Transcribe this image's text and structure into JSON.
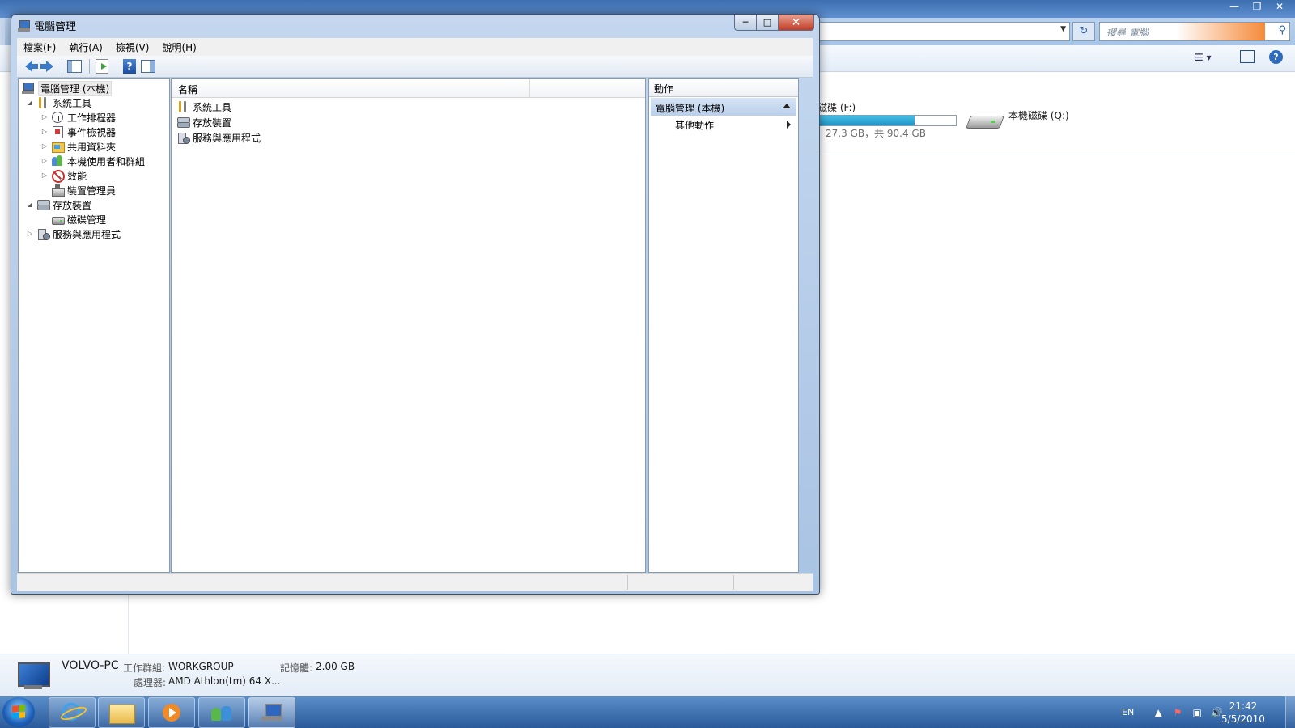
{
  "background_explorer": {
    "search_placeholder": "搜尋 電腦",
    "drive_f": {
      "label": "磁碟 (F:)",
      "info": "27.3 GB，共 90.4 GB",
      "used_fraction": 0.7
    },
    "drive_q": {
      "label": "本機磁碟 (Q:)"
    },
    "details": {
      "pc_name": "VOLVO-PC",
      "workgroup_label": "工作群組:",
      "workgroup_value": "WORKGROUP",
      "memory_label": "記憶體:",
      "memory_value": "2.00 GB",
      "processor_label": "處理器:",
      "processor_value": "AMD Athlon(tm) 64 X..."
    }
  },
  "window": {
    "title": "電腦管理"
  },
  "menu": {
    "items": [
      "檔案(F)",
      "執行(A)",
      "檢視(V)",
      "說明(H)"
    ]
  },
  "tree": {
    "root": "電腦管理 (本機)",
    "items": [
      {
        "label": "系統工具",
        "level": 1,
        "expander": "expanded"
      },
      {
        "label": "工作排程器",
        "level": 2,
        "expander": "collapsed"
      },
      {
        "label": "事件檢視器",
        "level": 2,
        "expander": "collapsed"
      },
      {
        "label": "共用資料夾",
        "level": 2,
        "expander": "collapsed"
      },
      {
        "label": "本機使用者和群組",
        "level": 2,
        "expander": "collapsed"
      },
      {
        "label": "效能",
        "level": 2,
        "expander": "collapsed"
      },
      {
        "label": "裝置管理員",
        "level": 2,
        "expander": "none"
      },
      {
        "label": "存放裝置",
        "level": 1,
        "expander": "expanded"
      },
      {
        "label": "磁碟管理",
        "level": 2,
        "expander": "none"
      },
      {
        "label": "服務與應用程式",
        "level": 1,
        "expander": "collapsed"
      }
    ]
  },
  "list": {
    "column_name": "名稱",
    "rows": [
      "系統工具",
      "存放裝置",
      "服務與應用程式"
    ]
  },
  "actions": {
    "header": "動作",
    "section": "電腦管理 (本機)",
    "items": [
      "其他動作"
    ]
  },
  "taskbar": {
    "language": "EN",
    "time": "21:42",
    "date": "5/5/2010"
  },
  "colors": {
    "taskbar": "#2a5a9a",
    "title_bar": "#c4d7ef",
    "action_section": "#b9cfea",
    "drive_bar_fill": "#1f93c6"
  }
}
